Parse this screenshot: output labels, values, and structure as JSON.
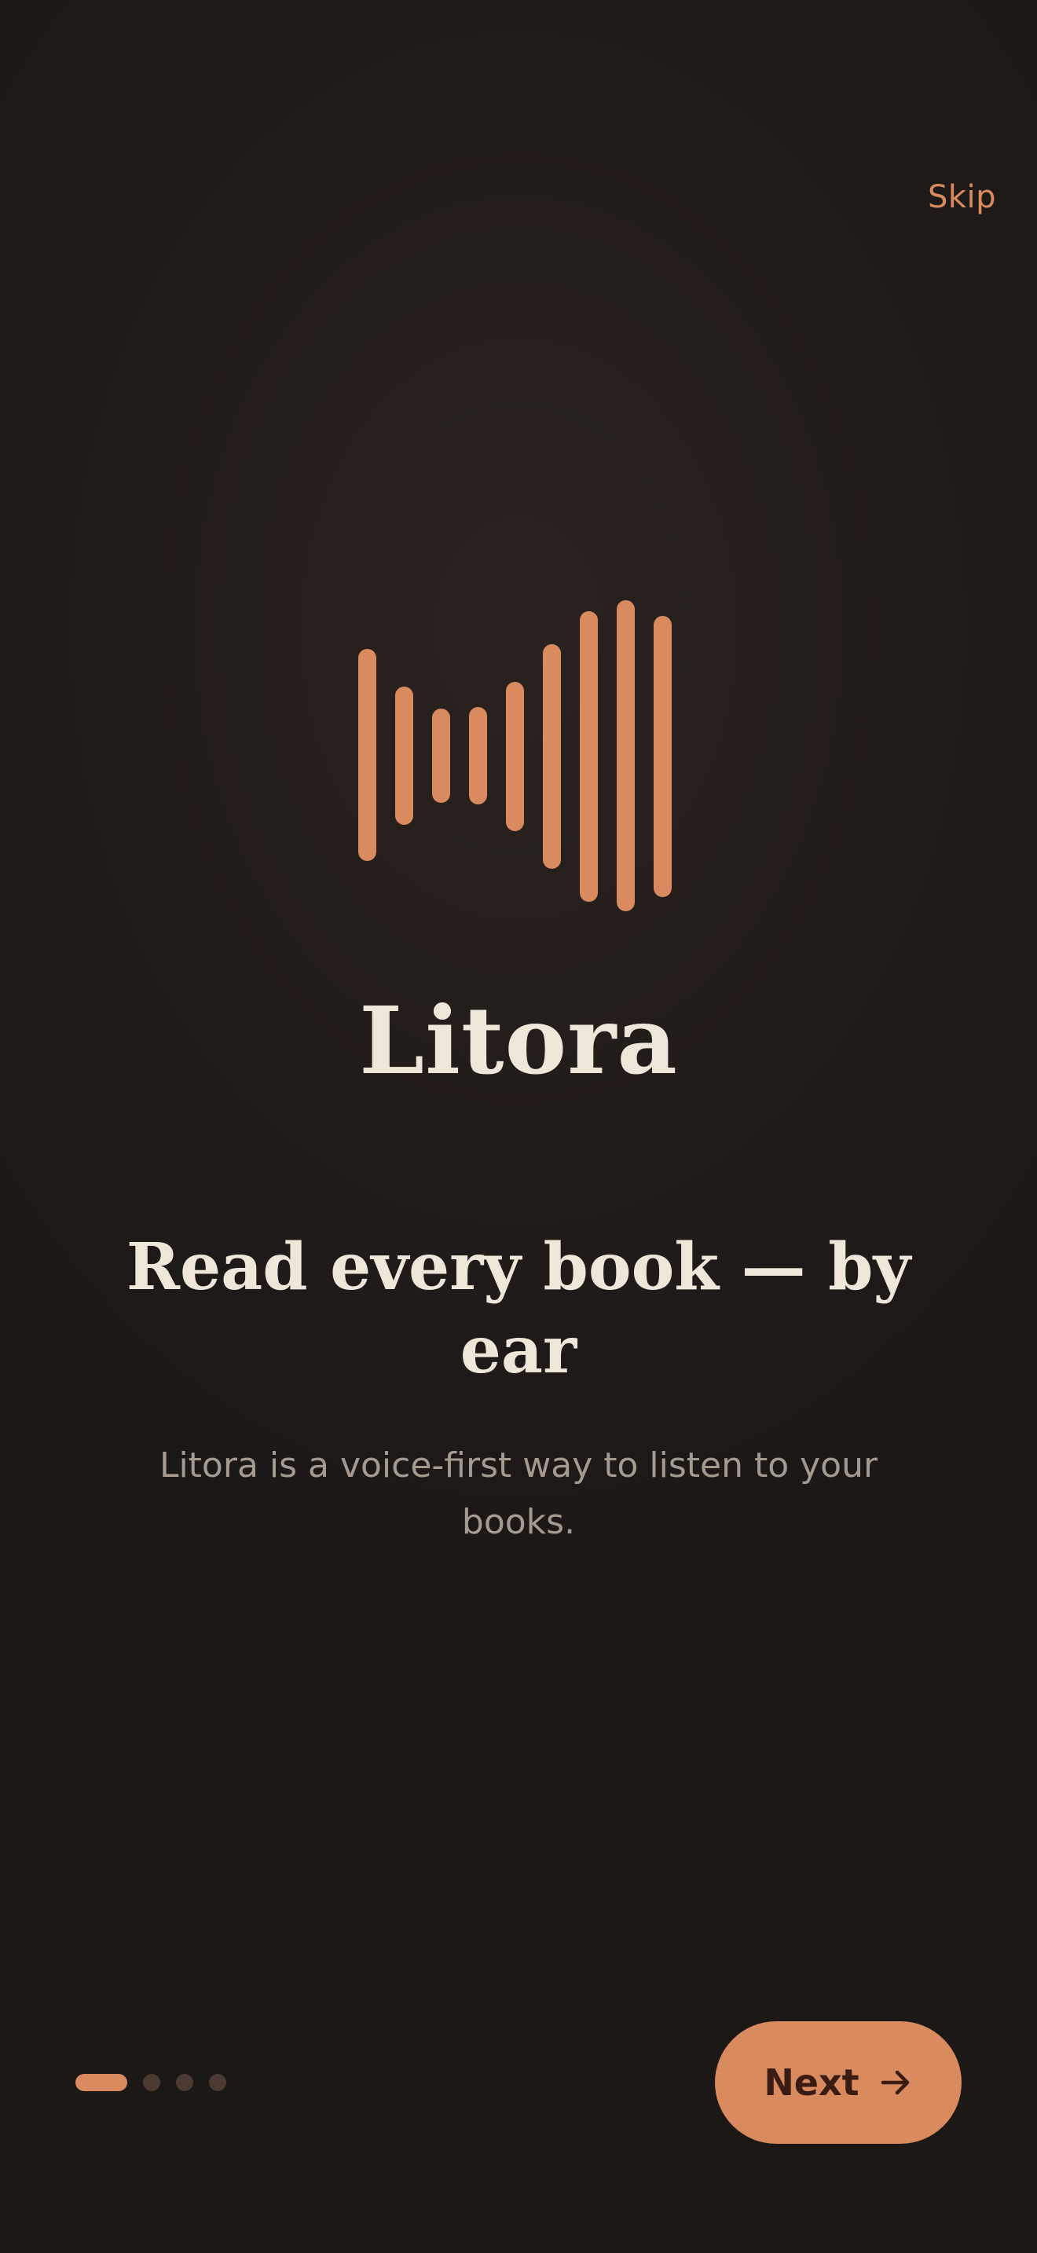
{
  "header": {
    "skip_label": "Skip"
  },
  "hero": {
    "logo_icon": "sound-wave-icon",
    "brand_name": "Litora"
  },
  "content": {
    "headline": "Read every book — by ear",
    "subtitle": "Litora is a voice-first way to listen to your books."
  },
  "footer": {
    "page_indicator": {
      "total": 4,
      "current": 1
    },
    "next_label": "Next",
    "next_icon": "arrow-right-icon"
  },
  "colors": {
    "accent": "#d98a5f",
    "background": "#1f1a17",
    "text_primary": "#efe6da",
    "text_secondary": "#a59a8f",
    "dot_inactive": "#4a3a31"
  }
}
